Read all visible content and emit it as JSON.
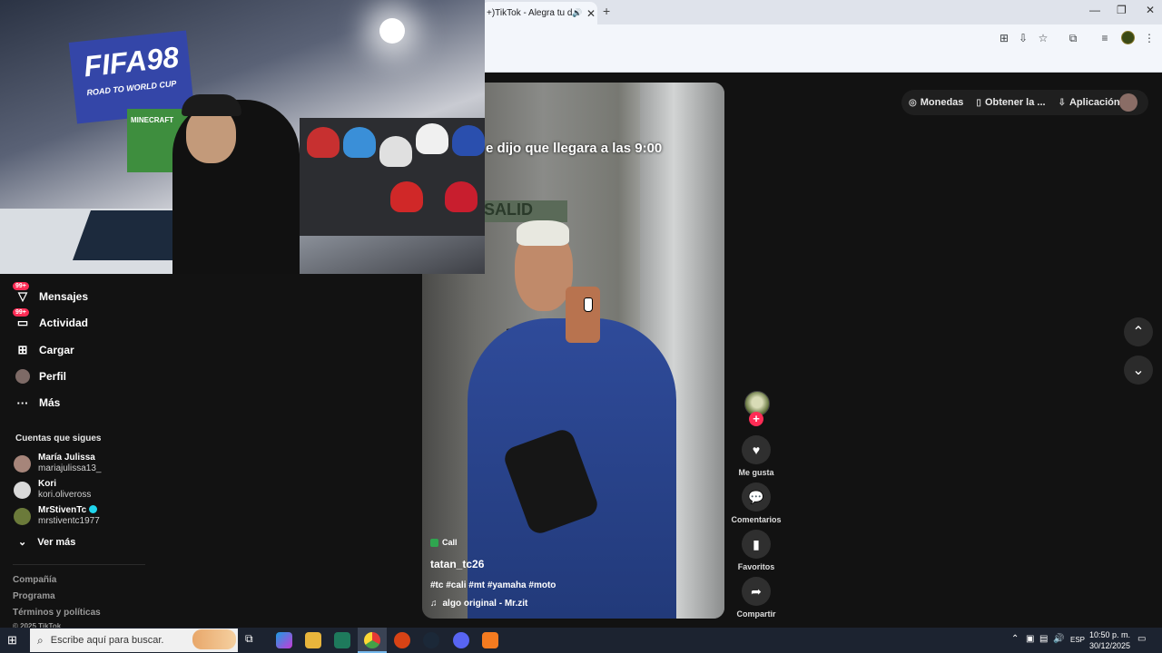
{
  "browser": {
    "tab_title": "+)TikTok - Alegra tu día",
    "new_tab": "+",
    "close": "✕",
    "minimize": "—",
    "restore": "❐",
    "window_close": "✕"
  },
  "header": {
    "coins": "Monedas",
    "get_app": "Obtener la ...",
    "app": "Aplicación ..."
  },
  "sidebar": {
    "items": [
      {
        "label": "Mensajes",
        "badge": "99+"
      },
      {
        "label": "Actividad",
        "badge": "99+"
      },
      {
        "label": "Cargar",
        "badge": ""
      },
      {
        "label": "Perfil",
        "badge": ""
      },
      {
        "label": "Más",
        "badge": ""
      }
    ],
    "following_title": "Cuentas que sigues",
    "following": [
      {
        "name": "María Julissa",
        "user": "mariajulissa13_"
      },
      {
        "name": "Kori",
        "user": "kori.oliveross"
      },
      {
        "name": "MrStivenTc",
        "user": "mrstiventc1977"
      }
    ],
    "see_more": "Ver más",
    "footer": [
      "Compañía",
      "Programa",
      "Términos y políticas",
      "© 2025 TikTok"
    ]
  },
  "webcam": {
    "poster_text": "FIFA98",
    "poster_sub": "ROAD TO WORLD CUP",
    "poster_game": "MINECRAFT"
  },
  "video": {
    "caption": "e dijo que llegara a las 9:00",
    "sign": "SALID",
    "call_tag": "Call",
    "author": "tatan_tc26",
    "hashtags": "#tc #cali #mt #yamaha #moto",
    "music": "algo original - Mr.zit"
  },
  "actions": {
    "like": "Me gusta",
    "comments": "Comentarios",
    "favorites": "Favoritos",
    "share": "Compartir"
  },
  "taskbar": {
    "search_placeholder": "Escribe aquí para buscar.",
    "lang": "ESP",
    "time": "10:50 p. m.",
    "date": "30/12/2025"
  },
  "icons": {
    "like": "heart-icon",
    "comments": "comment-icon",
    "favorites": "bookmark-icon",
    "share": "share-icon"
  },
  "colors": {
    "accent": "#fe2c55",
    "background": "#121212",
    "taskbar": "#1c2330"
  }
}
